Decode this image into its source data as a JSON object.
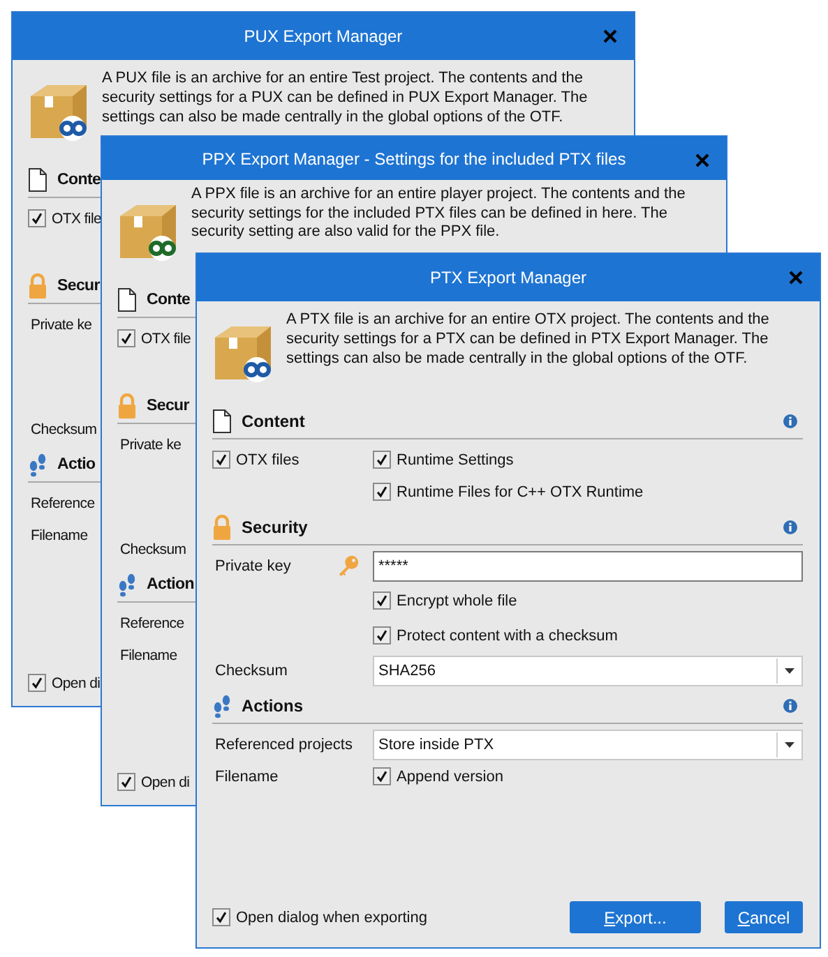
{
  "windows": [
    {
      "title": "PUX Export Manager",
      "color": "#1f5aa6",
      "description": [
        "A PUX file is an archive for an entire Test project. The contents and the",
        "security settings for a PUX can be defined in PUX Export Manager. The",
        "settings can also be made centrally in the global options of the OTF."
      ],
      "sections": [
        {
          "kind": "content",
          "title": "Conte",
          "rows": [
            {
              "left": {
                "kind": "checkbox",
                "label": "OTX file",
                "checked": true
              }
            }
          ]
        },
        {
          "kind": "security",
          "title": "Secur",
          "rows": [
            {
              "left": {
                "kind": "text",
                "text": "Private ke"
              }
            },
            {
              "left": {
                "kind": "text",
                "text": "Checksum"
              }
            }
          ]
        },
        {
          "kind": "actions",
          "title": "Actio",
          "rows": [
            {
              "left": {
                "kind": "text",
                "text": "Reference"
              }
            },
            {
              "left": {
                "kind": "text",
                "text": "Filename"
              }
            }
          ]
        }
      ],
      "footer": {
        "kind": "checkbox",
        "label": "Open di",
        "checked": true
      }
    },
    {
      "title": "PPX Export Manager - Settings for the included PTX files",
      "color": "#1e6b2a",
      "description": [
        "A PPX file is an archive for an entire player project. The contents and the",
        "security settings for the included PTX files can be defined in here. The",
        "security setting are also valid for the PPX file."
      ],
      "sections": [
        {
          "kind": "content",
          "title": "Conte",
          "rows": [
            {
              "left": {
                "kind": "checkbox",
                "label": "OTX file",
                "checked": true
              }
            }
          ]
        },
        {
          "kind": "security",
          "title": "Secur",
          "rows": [
            {
              "left": {
                "kind": "text",
                "text": "Private ke"
              }
            },
            {
              "left": {
                "kind": "text",
                "text": "Checksum"
              }
            }
          ]
        },
        {
          "kind": "actions",
          "title": "Action",
          "rows": [
            {
              "left": {
                "kind": "text",
                "text": "Reference"
              }
            },
            {
              "left": {
                "kind": "text",
                "text": "Filename"
              }
            }
          ]
        }
      ],
      "footer": {
        "kind": "checkbox",
        "label": "Open di",
        "checked": true
      }
    },
    {
      "title": "PTX Export Manager",
      "color": "#1f5aa6",
      "description": [
        "A PTX file is an archive for an entire OTX project. The contents and the",
        "security settings for a PTX can be defined in PTX Export Manager. The",
        "settings can also be made centrally in the global options of the OTF."
      ],
      "sections": [
        {
          "kind": "content",
          "title": "Content",
          "rows": [
            {
              "left": {
                "kind": "checkbox",
                "label": "OTX files",
                "checked": true
              },
              "right": {
                "kind": "checkbox",
                "label": "Runtime Settings",
                "checked": true
              }
            },
            {
              "right": {
                "kind": "checkbox",
                "label": "Runtime Files for C++ OTX Runtime",
                "checked": true
              }
            }
          ]
        },
        {
          "kind": "security",
          "title": "Security",
          "rows": [
            {
              "left": {
                "kind": "text",
                "text": "Private key"
              },
              "right": {
                "kind": "password",
                "value": "*****"
              }
            },
            {
              "right": {
                "kind": "checkbox",
                "label": "Encrypt whole file",
                "checked": true
              }
            },
            {
              "right": {
                "kind": "checkbox",
                "label": "Protect content with a checksum",
                "checked": true
              }
            },
            {
              "left": {
                "kind": "text",
                "text": "Checksum"
              },
              "right": {
                "kind": "dropdown",
                "value": "SHA256"
              }
            }
          ]
        },
        {
          "kind": "actions",
          "title": "Actions",
          "rows": [
            {
              "left": {
                "kind": "text",
                "text": "Referenced projects"
              },
              "right": {
                "kind": "dropdown",
                "value": "Store inside PTX"
              }
            },
            {
              "left": {
                "kind": "text",
                "text": "Filename"
              },
              "right": {
                "kind": "checkbox",
                "label": "Append version",
                "checked": true
              }
            }
          ]
        }
      ],
      "footer": {
        "kind": "checkbox",
        "label": "Open dialog when exporting",
        "checked": true
      },
      "buttons": [
        "Export...",
        "Cancel"
      ]
    }
  ]
}
